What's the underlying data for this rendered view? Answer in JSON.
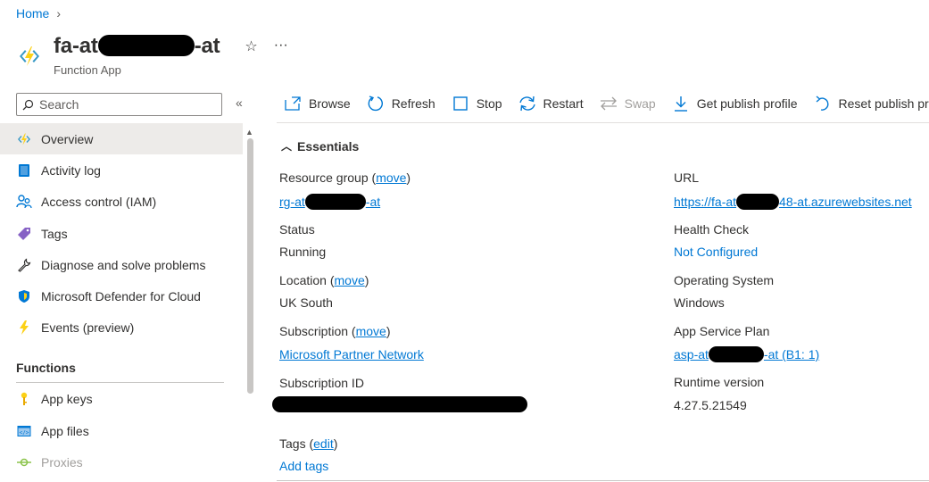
{
  "breadcrumb": {
    "home": "Home"
  },
  "header": {
    "title_prefix": "fa-at",
    "title_suffix": "-at",
    "subtitle": "Function App",
    "favorite_icon": "star-icon",
    "more_icon": "ellipsis-icon",
    "more_glyph": "···"
  },
  "sidebar": {
    "search_placeholder": "Search",
    "collapse_glyph": "«",
    "items": [
      {
        "label": "Overview",
        "icon": "function-app-icon"
      },
      {
        "label": "Activity log",
        "icon": "activity-log-icon"
      },
      {
        "label": "Access control (IAM)",
        "icon": "people-icon"
      },
      {
        "label": "Tags",
        "icon": "tag-icon"
      },
      {
        "label": "Diagnose and solve problems",
        "icon": "wrench-icon"
      },
      {
        "label": "Microsoft Defender for Cloud",
        "icon": "shield-icon"
      },
      {
        "label": "Events (preview)",
        "icon": "lightning-icon"
      }
    ],
    "section_functions": "Functions",
    "function_items": [
      {
        "label": "App keys",
        "icon": "key-icon"
      },
      {
        "label": "App files",
        "icon": "code-file-icon"
      },
      {
        "label": "Proxies",
        "icon": "proxy-icon"
      }
    ]
  },
  "toolbar": {
    "browse": "Browse",
    "refresh": "Refresh",
    "stop": "Stop",
    "restart": "Restart",
    "swap": "Swap",
    "get_publish_profile": "Get publish profile",
    "reset_publish_profile": "Reset publish profi"
  },
  "essentials": {
    "heading": "Essentials",
    "resource_group_label": "Resource group",
    "move": "move",
    "resource_group_prefix": "rg-at",
    "resource_group_suffix": "-at",
    "status_label": "Status",
    "status_value": "Running",
    "location_label": "Location",
    "location_value": "UK South",
    "subscription_label": "Subscription",
    "subscription_value": "Microsoft Partner Network",
    "subscription_id_label": "Subscription ID",
    "url_label": "URL",
    "url_prefix": "https://fa-at",
    "url_suffix": "48-at.azurewebsites.net",
    "health_check_label": "Health Check",
    "health_check_value": "Not Configured",
    "os_label": "Operating System",
    "os_value": "Windows",
    "plan_label": "App Service Plan",
    "plan_prefix": "asp-at",
    "plan_suffix": "-at (B1: 1)",
    "runtime_label": "Runtime version",
    "runtime_value": "4.27.5.21549",
    "tags_label": "Tags",
    "edit": "edit",
    "add_tags": "Add tags"
  },
  "colors": {
    "accent": "#0078d4",
    "function_yellow": "#fcd116",
    "function_blue": "#3999c6"
  }
}
